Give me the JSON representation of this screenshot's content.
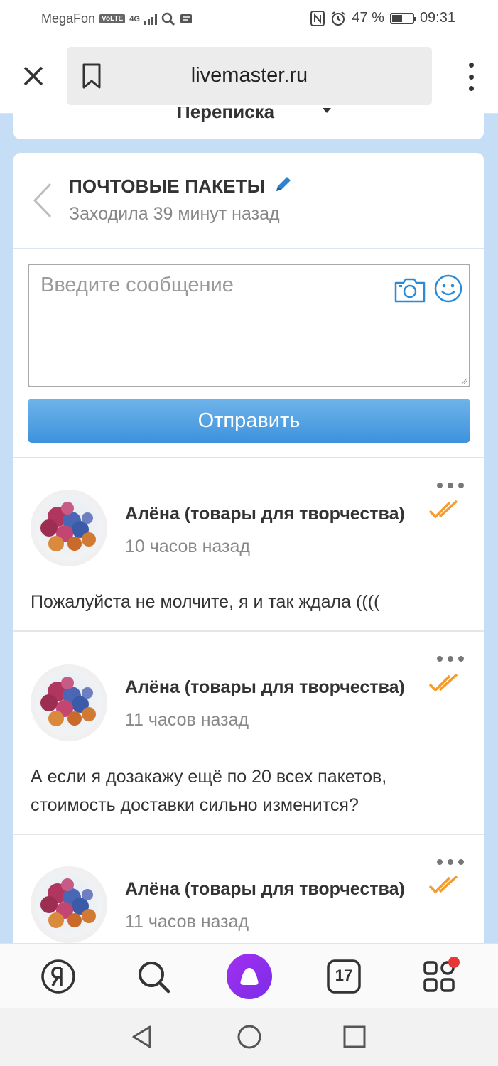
{
  "status_bar": {
    "carrier": "MegaFon",
    "volte": "VoLTE",
    "network": "4G",
    "battery": "47 %",
    "time": "09:31"
  },
  "browser": {
    "url": "livemaster.ru"
  },
  "top_card": {
    "title": "Переписка"
  },
  "chat": {
    "title": "ПОЧТОВЫЕ ПАКЕТЫ",
    "last_seen": "Заходила 39 минут назад",
    "input_placeholder": "Введите сообщение",
    "send_label": "Отправить"
  },
  "messages": [
    {
      "author": "Алёна (товары для творчества)",
      "time": "10 часов назад",
      "text": "Пожалуйста не молчите, я и так ждала (((("
    },
    {
      "author": "Алёна (товары для творчества)",
      "time": "11 часов назад",
      "text": "А если я дозакажу ещё по 20 всех пакетов, стоимость доставки сильно изменится?"
    },
    {
      "author": "Алёна (товары для творчества)",
      "time": "11 часов назад",
      "text": ""
    }
  ],
  "bottom_nav": {
    "tabs_count": "17"
  },
  "colors": {
    "accent": "#3d92dc",
    "read_ticks": "#f39c2f",
    "alice": "#8f2eec",
    "page_bg": "#c5def5"
  }
}
